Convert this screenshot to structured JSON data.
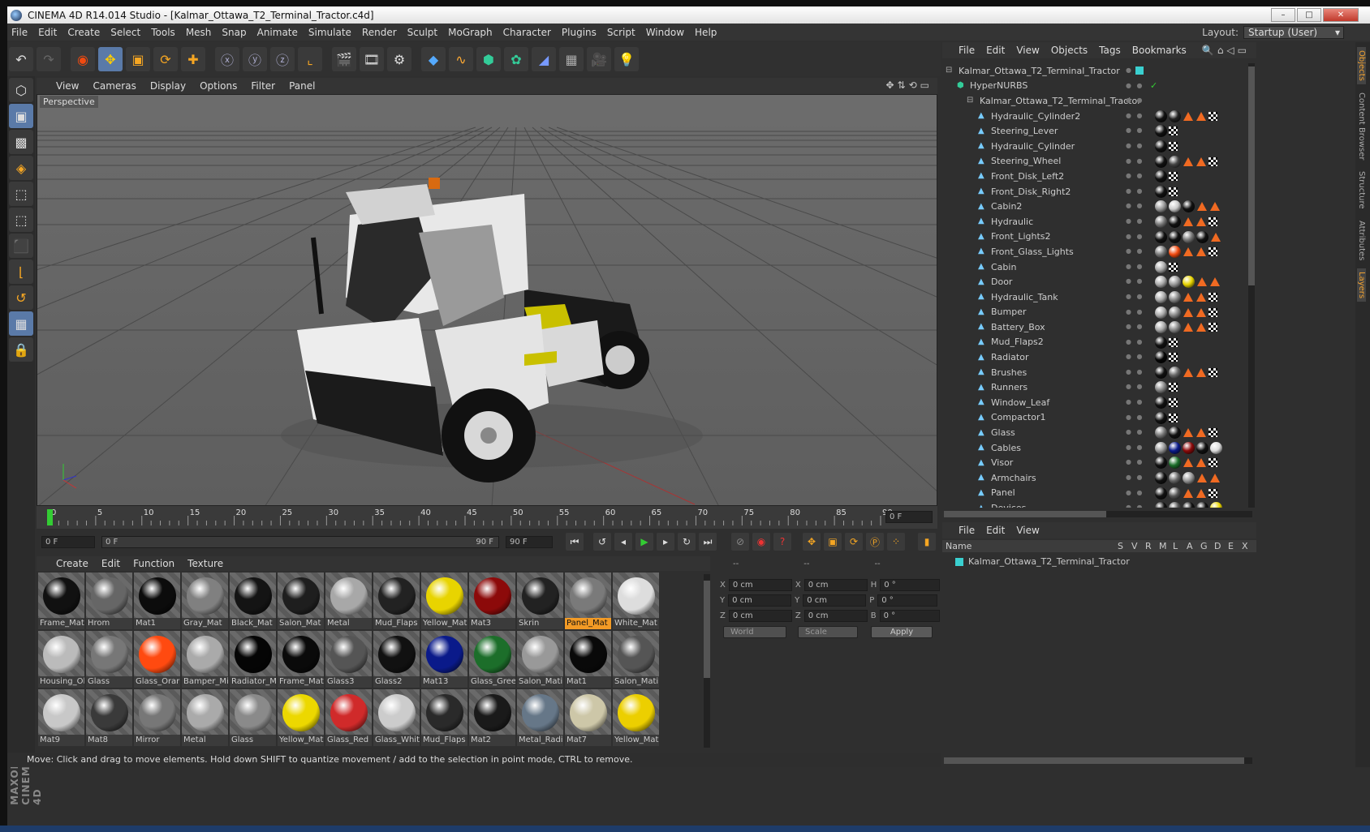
{
  "window": {
    "title": "CINEMA 4D R14.014 Studio - [Kalmar_Ottawa_T2_Terminal_Tractor.c4d]",
    "buttons": [
      "–",
      "□",
      "✕"
    ]
  },
  "menubar": [
    "File",
    "Edit",
    "Create",
    "Select",
    "Tools",
    "Mesh",
    "Snap",
    "Animate",
    "Simulate",
    "Render",
    "Sculpt",
    "MoGraph",
    "Character",
    "Plugins",
    "Script",
    "Window",
    "Help"
  ],
  "layout": {
    "label": "Layout:",
    "value": "Startup (User)"
  },
  "viewport": {
    "menu": [
      "View",
      "Cameras",
      "Display",
      "Options",
      "Filter",
      "Panel"
    ],
    "label": "Perspective"
  },
  "timeline": {
    "ticks": [
      "0",
      "5",
      "10",
      "15",
      "20",
      "25",
      "30",
      "35",
      "40",
      "45",
      "50",
      "55",
      "60",
      "65",
      "70",
      "75",
      "80",
      "85",
      "90"
    ],
    "frame": "0 F"
  },
  "playbar": {
    "start": "0 F",
    "slider_start": "0 F",
    "slider_end": "90 F",
    "end": "90 F"
  },
  "materials": {
    "menu": [
      "Create",
      "Edit",
      "Function",
      "Texture"
    ],
    "items": [
      {
        "name": "Frame_Mat",
        "color": "#111111"
      },
      {
        "name": "Hrom",
        "color": "#666666"
      },
      {
        "name": "Mat1",
        "color": "#0c0c0c"
      },
      {
        "name": "Gray_Mat",
        "color": "#808080"
      },
      {
        "name": "Black_Mat",
        "color": "#141414"
      },
      {
        "name": "Salon_Mat",
        "color": "#1e1e1e"
      },
      {
        "name": "Metal",
        "color": "#a8a8a8"
      },
      {
        "name": "Mud_Flaps",
        "color": "#222222"
      },
      {
        "name": "Yellow_Mat",
        "color": "#e8d400"
      },
      {
        "name": "Mat3",
        "color": "#8c0a0a"
      },
      {
        "name": "Skrin",
        "color": "#222222"
      },
      {
        "name": "Panel_Mat",
        "color": "#7a7a7a",
        "selected": true
      },
      {
        "name": "White_Mat",
        "color": "#dddddd"
      },
      {
        "name": "Housing_Ol",
        "color": "#bbbbbb"
      },
      {
        "name": "Glass",
        "color": "#777777"
      },
      {
        "name": "Glass_Orar",
        "color": "#ff4a10"
      },
      {
        "name": "Bamper_Mi",
        "color": "#aaaaaa"
      },
      {
        "name": "Radiator_M",
        "color": "#050505"
      },
      {
        "name": "Frame_Mat",
        "color": "#0a0a0a"
      },
      {
        "name": "Glass3",
        "color": "#555555"
      },
      {
        "name": "Glass2",
        "color": "#111111"
      },
      {
        "name": "Mat13",
        "color": "#0a1a8a"
      },
      {
        "name": "Glass_Gree",
        "color": "#1c6e2a"
      },
      {
        "name": "Salon_Mati",
        "color": "#999999"
      },
      {
        "name": "Mat1",
        "color": "#090909"
      },
      {
        "name": "Salon_Mati",
        "color": "#555555"
      },
      {
        "name": "Mat9",
        "color": "#c8c8c8"
      },
      {
        "name": "Mat8",
        "color": "#3a3a3a"
      },
      {
        "name": "Mirror",
        "color": "#777777"
      },
      {
        "name": "Metal",
        "color": "#aaaaaa"
      },
      {
        "name": "Glass",
        "color": "#8a8a8a"
      },
      {
        "name": "Yellow_Mat",
        "color": "#ecd800"
      },
      {
        "name": "Glass_Red",
        "color": "#d02a2a"
      },
      {
        "name": "Glass_Whit",
        "color": "#cccccc"
      },
      {
        "name": "Mud_Flaps",
        "color": "#2a2a2a"
      },
      {
        "name": "Mat2",
        "color": "#1a1a1a"
      },
      {
        "name": "Metal_Radi",
        "color": "#667788"
      },
      {
        "name": "Mat7",
        "color": "#cdc7a8"
      },
      {
        "name": "Yellow_Mat",
        "color": "#eccf00"
      }
    ]
  },
  "coords": {
    "headers": [
      "--",
      "--",
      "--"
    ],
    "rows": [
      {
        "a": "X",
        "av": "0 cm",
        "b": "X",
        "bv": "0 cm",
        "c": "H",
        "cv": "0 °"
      },
      {
        "a": "Y",
        "av": "0 cm",
        "b": "Y",
        "bv": "0 cm",
        "c": "P",
        "cv": "0 °"
      },
      {
        "a": "Z",
        "av": "0 cm",
        "b": "Z",
        "bv": "0 cm",
        "c": "B",
        "cv": "0 °"
      }
    ],
    "world": "World",
    "scale": "Scale",
    "apply": "Apply"
  },
  "status": "Move: Click and drag to move elements. Hold down SHIFT to quantize movement / add to the selection in point mode, CTRL to remove.",
  "objects": {
    "menu": [
      "File",
      "Edit",
      "View",
      "Objects",
      "Tags",
      "Bookmarks"
    ],
    "root": "Kalmar_Ottawa_T2_Terminal_Tractor",
    "hypernurbs": "HyperNURBS",
    "group": "Kalmar_Ottawa_T2_Terminal_Tractor",
    "items": [
      {
        "name": "Hydraulic_Cylinder2",
        "tags": [
          "#111",
          "#222",
          "tri",
          "tri",
          "chk"
        ]
      },
      {
        "name": "Steering_Lever",
        "tags": [
          "#111",
          "chk"
        ]
      },
      {
        "name": "Hydraulic_Cylinder",
        "tags": [
          "#111",
          "chk"
        ]
      },
      {
        "name": "Steering_Wheel",
        "tags": [
          "#111",
          "#444",
          "tri",
          "tri",
          "chk"
        ]
      },
      {
        "name": "Front_Disk_Left2",
        "tags": [
          "#111",
          "chk"
        ]
      },
      {
        "name": "Front_Disk_Right2",
        "tags": [
          "#111",
          "chk"
        ]
      },
      {
        "name": "Cabin2",
        "tags": [
          "#999",
          "#ccc",
          "#111",
          "tri",
          "tri"
        ]
      },
      {
        "name": "Hydraulic",
        "tags": [
          "#777",
          "#111",
          "tri",
          "tri",
          "chk"
        ]
      },
      {
        "name": "Front_Lights2",
        "tags": [
          "#111",
          "#111",
          "#777",
          "#111",
          "tri"
        ]
      },
      {
        "name": "Front_Glass_Lights",
        "tags": [
          "#777",
          "#f04a10",
          "tri",
          "tri",
          "chk"
        ]
      },
      {
        "name": "Cabin",
        "tags": [
          "#aaa",
          "chk"
        ]
      },
      {
        "name": "Door",
        "tags": [
          "#aaa",
          "#999",
          "#e8d400",
          "tri",
          "tri"
        ]
      },
      {
        "name": "Hydraulic_Tank",
        "tags": [
          "#aaa",
          "#888",
          "tri",
          "tri",
          "chk"
        ]
      },
      {
        "name": "Bumper",
        "tags": [
          "#aaa",
          "#888",
          "tri",
          "tri",
          "chk"
        ]
      },
      {
        "name": "Battery_Box",
        "tags": [
          "#aaa",
          "#888",
          "tri",
          "tri",
          "chk"
        ]
      },
      {
        "name": "Mud_Flaps2",
        "tags": [
          "#111",
          "chk"
        ]
      },
      {
        "name": "Radiator",
        "tags": [
          "#050505",
          "chk"
        ]
      },
      {
        "name": "Brushes",
        "tags": [
          "#111",
          "#666",
          "tri",
          "tri",
          "chk"
        ]
      },
      {
        "name": "Runners",
        "tags": [
          "#888",
          "chk"
        ]
      },
      {
        "name": "Window_Leaf",
        "tags": [
          "#111",
          "chk"
        ]
      },
      {
        "name": "Compactor1",
        "tags": [
          "#111",
          "chk"
        ]
      },
      {
        "name": "Glass",
        "tags": [
          "#777",
          "#111",
          "tri",
          "tri",
          "chk"
        ]
      },
      {
        "name": "Cables",
        "tags": [
          "#999",
          "#0a1a8a",
          "#8c0a0a",
          "#111",
          "#ddd"
        ]
      },
      {
        "name": "Visor",
        "tags": [
          "#111",
          "#1c6e2a",
          "tri",
          "tri",
          "chk"
        ]
      },
      {
        "name": "Armchairs",
        "tags": [
          "#111",
          "#666",
          "#999",
          "tri",
          "tri"
        ]
      },
      {
        "name": "Panel",
        "tags": [
          "#111",
          "#555",
          "tri",
          "tri",
          "chk"
        ]
      },
      {
        "name": "Devices",
        "tags": [
          "#111",
          "#555",
          "#111",
          "#111",
          "#e8d400"
        ]
      }
    ]
  },
  "layers": {
    "menu": [
      "File",
      "Edit",
      "View"
    ],
    "headers": "Name",
    "cols": [
      "S",
      "V",
      "R",
      "M",
      "L",
      "A",
      "G",
      "D",
      "E",
      "X"
    ],
    "item": "Kalmar_Ottawa_T2_Terminal_Tractor"
  },
  "right_tabs": [
    "Objects",
    "Content Browser",
    "Structure",
    "Attributes",
    "Layers"
  ],
  "accent": "#f29a25"
}
